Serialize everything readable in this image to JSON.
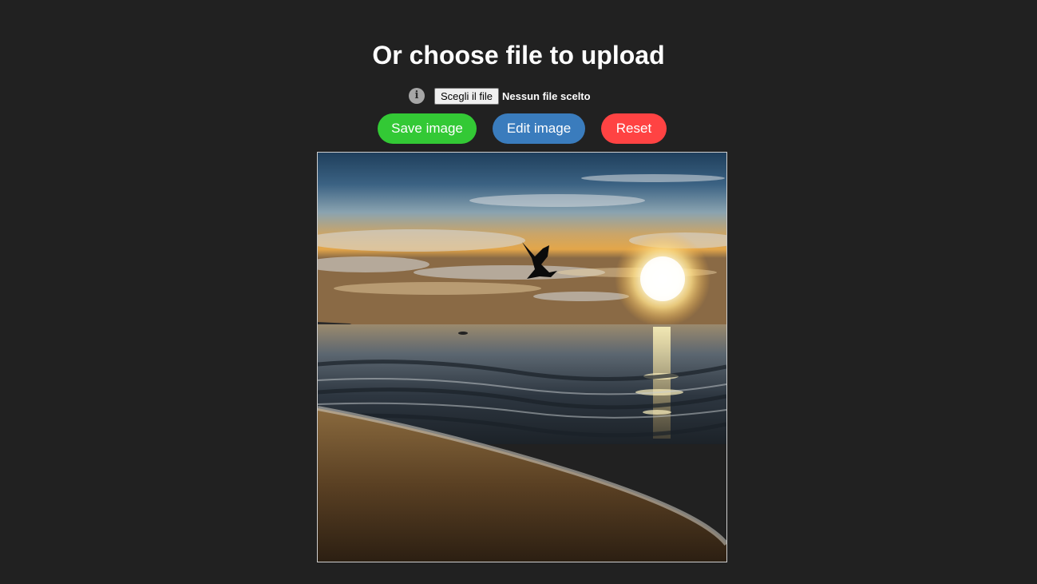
{
  "header": {
    "title": "Or choose file to upload"
  },
  "file_input": {
    "info_icon": "info-icon",
    "button_label": "Scegli il file",
    "status_text": "Nessun file scelto"
  },
  "actions": {
    "save_label": "Save image",
    "edit_label": "Edit image",
    "reset_label": "Reset"
  },
  "colors": {
    "background": "#212121",
    "save": "#33c935",
    "edit": "#3a7cbd",
    "reset": "#ff4343"
  }
}
